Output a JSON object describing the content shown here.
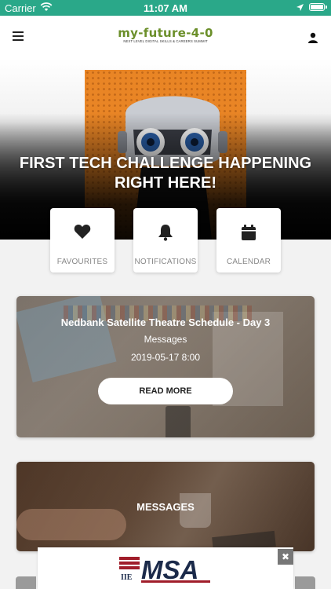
{
  "status_bar": {
    "carrier": "Carrier",
    "time": "11:07 AM",
    "wifi_icon": "wifi-icon",
    "location_icon": "location-arrow-icon",
    "battery_icon": "battery-icon",
    "background": "#2aa889"
  },
  "header": {
    "menu_icon": "hamburger-menu-icon",
    "logo_text": "my-future-4-0",
    "logo_tagline": "NEXT LEVEL DIGITAL SKILLS & CAREERS SUMMIT",
    "user_icon": "user-icon"
  },
  "hero": {
    "title": "FIRST TECH CHALLENGE HAPPENING RIGHT HERE!"
  },
  "quick_actions": [
    {
      "label": "FAVOURITES",
      "icon": "heart-icon"
    },
    {
      "label": "NOTIFICATIONS",
      "icon": "bell-icon"
    },
    {
      "label": "CALENDAR",
      "icon": "calendar-icon"
    }
  ],
  "cards": [
    {
      "title": "Nedbank Satellite Theatre Schedule - Day 3",
      "category": "Messages",
      "date": "2019-05-17 8:00",
      "button": "READ MORE"
    },
    {
      "title": "MESSAGES"
    }
  ],
  "ad": {
    "brand": "MSA",
    "sub_brand": "IIE",
    "close": "✖"
  },
  "colors": {
    "accent": "#2aa889",
    "logo_green": "#6b8f2a",
    "hero_orange": "#e98525"
  }
}
